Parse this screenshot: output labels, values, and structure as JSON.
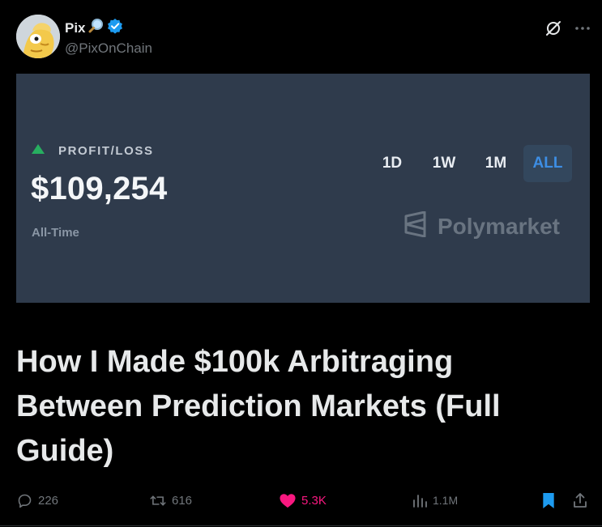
{
  "author": {
    "name": "Pix",
    "name_emoji": "magnifying-glass-icon",
    "verified": true,
    "handle": "@PixOnChain"
  },
  "header_actions": [
    "grok-icon",
    "more-icon"
  ],
  "card": {
    "trend_icon": "triangle-up-icon",
    "label": "PROFIT/LOSS",
    "value": "$109,254",
    "period": "All-Time",
    "tabs": [
      {
        "label": "1D",
        "active": false
      },
      {
        "label": "1W",
        "active": false
      },
      {
        "label": "1M",
        "active": false
      },
      {
        "label": "ALL",
        "active": true
      }
    ],
    "brand": "Polymarket",
    "colors": {
      "background": "#2f3b4c",
      "up": "#27ae60",
      "active_tab": "#3d8ee4"
    }
  },
  "title": "How I Made $100k Arbitraging Between Prediction Markets (Full Guide)",
  "stats": {
    "replies": "226",
    "reposts": "616",
    "likes": "5.3K",
    "views": "1.1M"
  },
  "colors": {
    "like": "#f91880",
    "bookmark": "#1d9bf0",
    "verified": "#1d9bf0"
  }
}
